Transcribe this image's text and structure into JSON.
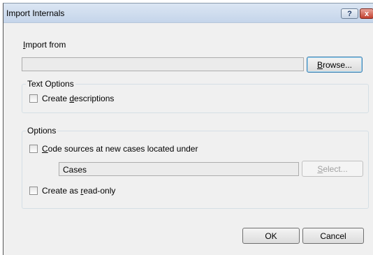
{
  "dialog": {
    "title": "Import Internals",
    "help_glyph": "?",
    "close_glyph": "x"
  },
  "import_from": {
    "label_first": "I",
    "label_rest": "mport from",
    "path_value": "",
    "browse_first": "B",
    "browse_rest": "rowse..."
  },
  "text_options": {
    "title": "Text Options",
    "create_desc_before": "Create ",
    "create_desc_underline": "d",
    "create_desc_after": "escriptions"
  },
  "options": {
    "title": "Options",
    "code_sources_first": "C",
    "code_sources_rest": "ode sources at new cases located under",
    "cases_value": "Cases",
    "select_first": "S",
    "select_rest": "elect...",
    "read_only_before": "Create as ",
    "read_only_underline": "r",
    "read_only_after": "ead-only"
  },
  "footer": {
    "ok_label": "OK",
    "cancel_label": "Cancel"
  },
  "icons": {
    "help": "help-icon",
    "close": "close-icon"
  }
}
